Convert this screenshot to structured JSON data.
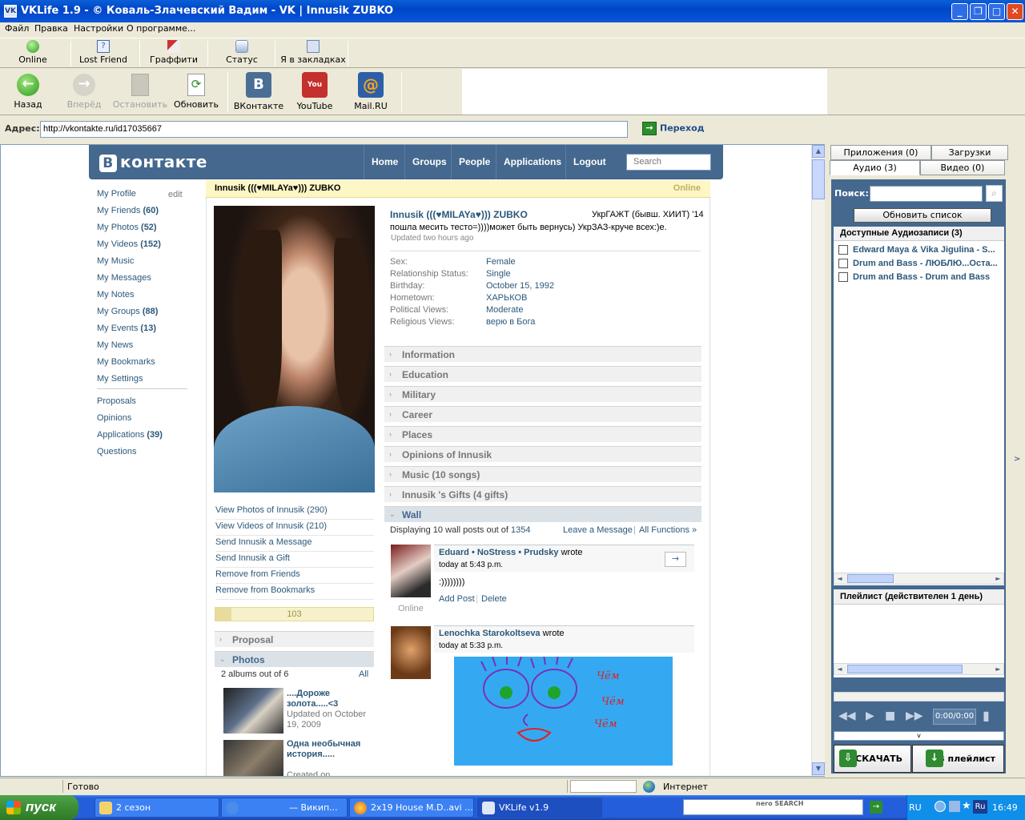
{
  "window": {
    "title": "VKLife 1.9 - © Коваль-Злачевский Вадим - VK  |  Innusik ZUBKO",
    "icon_text": "VK"
  },
  "menu": [
    "Файл",
    "Правка",
    "Настройки",
    "О программе..."
  ],
  "toolbar1": [
    {
      "label": "Online",
      "icon": "online-icon"
    },
    {
      "label": "Lost Friend",
      "icon": "question-icon"
    },
    {
      "label": "Граффити",
      "icon": "graffiti-icon"
    },
    {
      "label": "Статус",
      "icon": "status-icon"
    },
    {
      "label": "Я в закладках",
      "icon": "bookmark-icon"
    }
  ],
  "toolbar2": [
    {
      "label": "Назад",
      "icon": "back-arrow-icon",
      "enabled": true
    },
    {
      "label": "Вперёд",
      "icon": "forward-arrow-icon",
      "enabled": false
    },
    {
      "label": "Остановить",
      "icon": "stop-icon",
      "enabled": false
    },
    {
      "label": "Обновить",
      "icon": "refresh-icon",
      "enabled": true
    },
    {
      "label": "ВКонтакте",
      "icon": "vk-icon",
      "enabled": true
    },
    {
      "label": "YouTube",
      "icon": "youtube-icon",
      "enabled": true
    },
    {
      "label": "Mail.RU",
      "icon": "mailru-icon",
      "enabled": true
    }
  ],
  "address": {
    "label": "Адрес:",
    "value": "http://vkontakte.ru/id17035667",
    "go_label": "Переход"
  },
  "vk": {
    "logo": "контакте",
    "logo_letter": "В",
    "nav": [
      "Home",
      "Groups",
      "People",
      "Applications",
      "Logout"
    ],
    "search_placeholder": "Search",
    "left_nav": [
      {
        "label": "My Profile",
        "count": ""
      },
      {
        "label": "My Friends",
        "count": "(60)"
      },
      {
        "label": "My Photos",
        "count": "(52)"
      },
      {
        "label": "My Videos",
        "count": "(152)"
      },
      {
        "label": "My Music",
        "count": ""
      },
      {
        "label": "My Messages",
        "count": ""
      },
      {
        "label": "My Notes",
        "count": ""
      },
      {
        "label": "My Groups",
        "count": "(88)"
      },
      {
        "label": "My Events",
        "count": "(13)"
      },
      {
        "label": "My News",
        "count": ""
      },
      {
        "label": "My Bookmarks",
        "count": ""
      },
      {
        "label": "My Settings",
        "count": ""
      }
    ],
    "left_nav_edit": "edit",
    "left_nav2": [
      {
        "label": "Proposals",
        "count": ""
      },
      {
        "label": "Opinions",
        "count": ""
      },
      {
        "label": "Applications",
        "count": "(39)"
      },
      {
        "label": "Questions",
        "count": ""
      }
    ],
    "profile_header": {
      "name": "Innusik (((♥MILAYa♥))) ZUBKO",
      "status": "Online"
    },
    "profile": {
      "name": "Innusik (((♥MILAYa♥))) ZUBKO",
      "school": "УкрГАЖТ (бывш. ХИИТ) '14",
      "activity": "пошла месить тесто=))))может быть вернусь) УкрЗАЗ-круче всех:)e.",
      "updated": "Updated two hours ago",
      "fields": [
        {
          "label": "Sex:",
          "value": "Female"
        },
        {
          "label": "Relationship Status:",
          "value": "Single"
        },
        {
          "label": "Birthday:",
          "value": "October 15, 1992"
        },
        {
          "label": "Hometown:",
          "value": "ХАРЬКОВ"
        },
        {
          "label": "Political Views:",
          "value": "Moderate"
        },
        {
          "label": "Religious Views:",
          "value": "верю в Бога"
        }
      ],
      "sections": [
        "Information",
        "Education",
        "Military",
        "Career",
        "Places",
        "Opinions of Innusik",
        "Music (10 songs)",
        "Innusik 's Gifts (4 gifts)",
        "Wall"
      ]
    },
    "profile_links": [
      "View Photos of Innusik (290)",
      "View Videos of Innusik (210)",
      "Send Innusik a Message",
      "Send Innusik a Gift",
      "Remove from Friends",
      "Remove from Bookmarks"
    ],
    "rating": {
      "value": "103",
      "fill_fraction": 0.1
    },
    "left_sections": {
      "proposal": "Proposal",
      "photos": "Photos"
    },
    "albums": {
      "summary": "2 albums out of 6",
      "all_label": "All",
      "items": [
        {
          "title": "....Дороже золота.....<3",
          "sub": "Updated on October 19, 2009"
        },
        {
          "title": "Одна необычная история.....",
          "sub": "Created on"
        }
      ]
    },
    "wall": {
      "summary_prefix": "Displaying 10 wall posts out of",
      "total": "1354",
      "leave_message": "Leave a Message",
      "all_functions": "All Functions »",
      "posts": [
        {
          "author": "Eduard • NoStress • Prudsky",
          "verb": "wrote",
          "time": "today at 5:43 p.m.",
          "text": ":))))))))",
          "add_post": "Add Post",
          "delete": "Delete",
          "status": "Online"
        },
        {
          "author": "Lenochka Starokoltseva",
          "verb": "wrote",
          "time": "today at 5:33 p.m.",
          "graffiti": "Чём Чём Чём"
        }
      ]
    }
  },
  "right_panel": {
    "tabs_top": [
      "Приложения (0)",
      "Загрузки"
    ],
    "tabs_bottom": [
      "Аудио (3)",
      "Видео (0)"
    ],
    "search_label": "Поиск:",
    "refresh_label": "Обновить список",
    "audio_header": "Доступные Аудиозаписи (3)",
    "tracks": [
      "Edward Maya & Vika Jigulina - S...",
      "Drum and Bass - ЛЮБЛЮ...Оста...",
      "Drum and Bass - Drum and Bass"
    ],
    "playlist_header": "Плейлист (действителен 1 день)",
    "time": "0:00/0:00",
    "collapse": "v",
    "download_label": "СКАЧАТЬ",
    "to_playlist_label": "В плейлист"
  },
  "statusbar": {
    "text": "Готово",
    "zone": "Интернет"
  },
  "taskbar": {
    "start": "пуск",
    "tasks": [
      "2 сезон",
      "— Викип...",
      "2x19 House M.D..avi ...",
      "VKLife v1.9"
    ],
    "nero": "nero SEARCH",
    "lang": "RU",
    "clock": "16:49"
  },
  "colors": {
    "vk_blue": "#45688e",
    "link": "#2b587a",
    "xp_blue": "#245edb"
  }
}
